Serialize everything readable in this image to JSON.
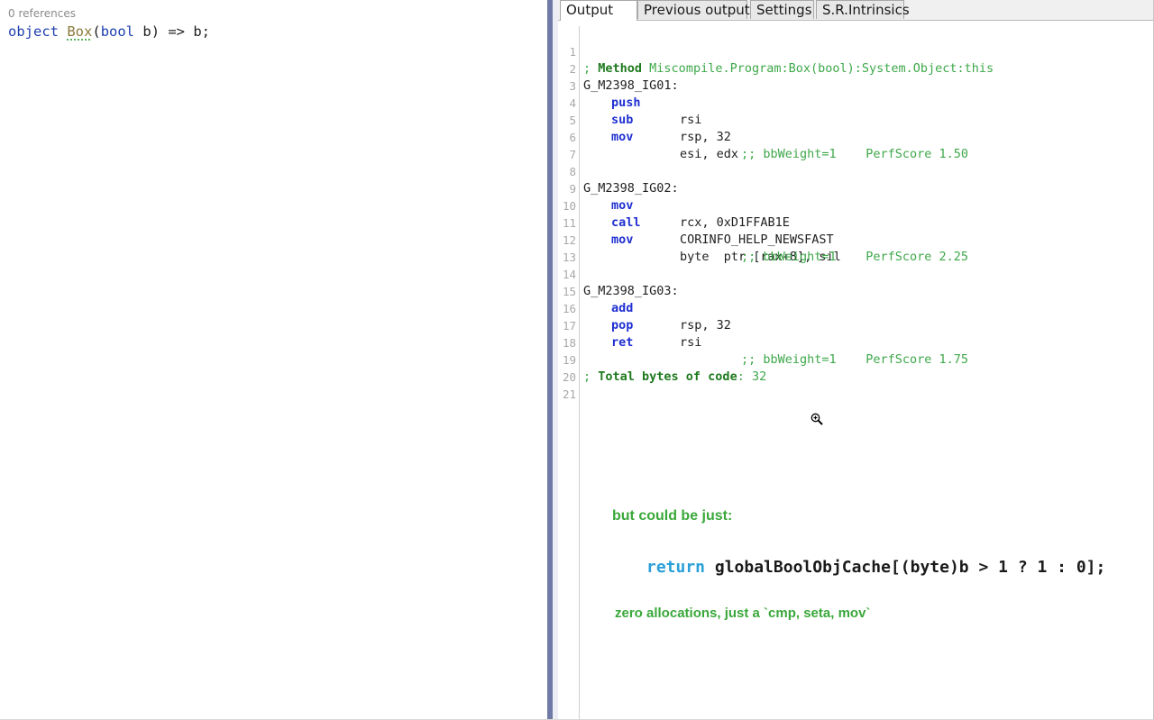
{
  "left_editor": {
    "codelens": "0 references",
    "code": {
      "kw_object": "object",
      "method": "Box",
      "open_paren": "(",
      "kw_bool": "bool",
      "param": " b",
      "rest": ") => b;"
    }
  },
  "tabs": [
    {
      "label": "Output",
      "active": true
    },
    {
      "label": "Previous output",
      "active": false
    },
    {
      "label": "Settings",
      "active": false
    },
    {
      "label": "S.R.Intrinsics",
      "active": false
    }
  ],
  "asm": {
    "line_numbers": [
      "1",
      "2",
      "3",
      "4",
      "5",
      "6",
      "7",
      "8",
      "9",
      "10",
      "11",
      "12",
      "13",
      "14",
      "15",
      "16",
      "17",
      "18",
      "19",
      "20",
      "21"
    ],
    "l1": {
      "prefix": "; ",
      "kw": "Method",
      "text": " Miscompile.Program:Box(bool):System.Object:this"
    },
    "l2": "G_M2398_IG01:",
    "l3": {
      "mnem": "push",
      "oper": "rsi"
    },
    "l4": {
      "mnem": "sub",
      "oper": "rsp, 32"
    },
    "l5": {
      "mnem": "mov",
      "oper": "esi, edx"
    },
    "l6": {
      "weight": ";; bbWeight=1",
      "score": "PerfScore 1.50"
    },
    "l8": "G_M2398_IG02:",
    "l9": {
      "mnem": "mov",
      "oper": "rcx, 0xD1FFAB1E"
    },
    "l10": {
      "mnem": "call",
      "oper": "CORINFO_HELP_NEWSFAST"
    },
    "l11": {
      "mnem": "mov",
      "oper": "byte  ptr [rax+8], sil"
    },
    "l12": {
      "weight": ";; bbWeight=1",
      "score": "PerfScore 2.25"
    },
    "l14": "G_M2398_IG03:",
    "l15": {
      "mnem": "add",
      "oper": "rsp, 32"
    },
    "l16": {
      "mnem": "pop",
      "oper": "rsi"
    },
    "l17": {
      "mnem": "ret",
      "oper": ""
    },
    "l18": {
      "weight": ";; bbWeight=1",
      "score": "PerfScore 1.75"
    },
    "l19": {
      "prefix": "; ",
      "kw": "Total bytes of code",
      "text": ": 32"
    }
  },
  "annotation": {
    "title": "but could be just:",
    "code_return": "return",
    "code_rest": " globalBoolObjCache[(byte)b > 1 ? 1 : 0];",
    "footer": "zero allocations, just a `cmp, seta, mov`"
  },
  "icons": {
    "cursor": "zoom-in-icon"
  },
  "colors": {
    "splitter": "#6f7ba6",
    "mnemonic": "#1f2fd0",
    "comment": "#3ea84a",
    "return_keyword": "#2a9fd8"
  }
}
